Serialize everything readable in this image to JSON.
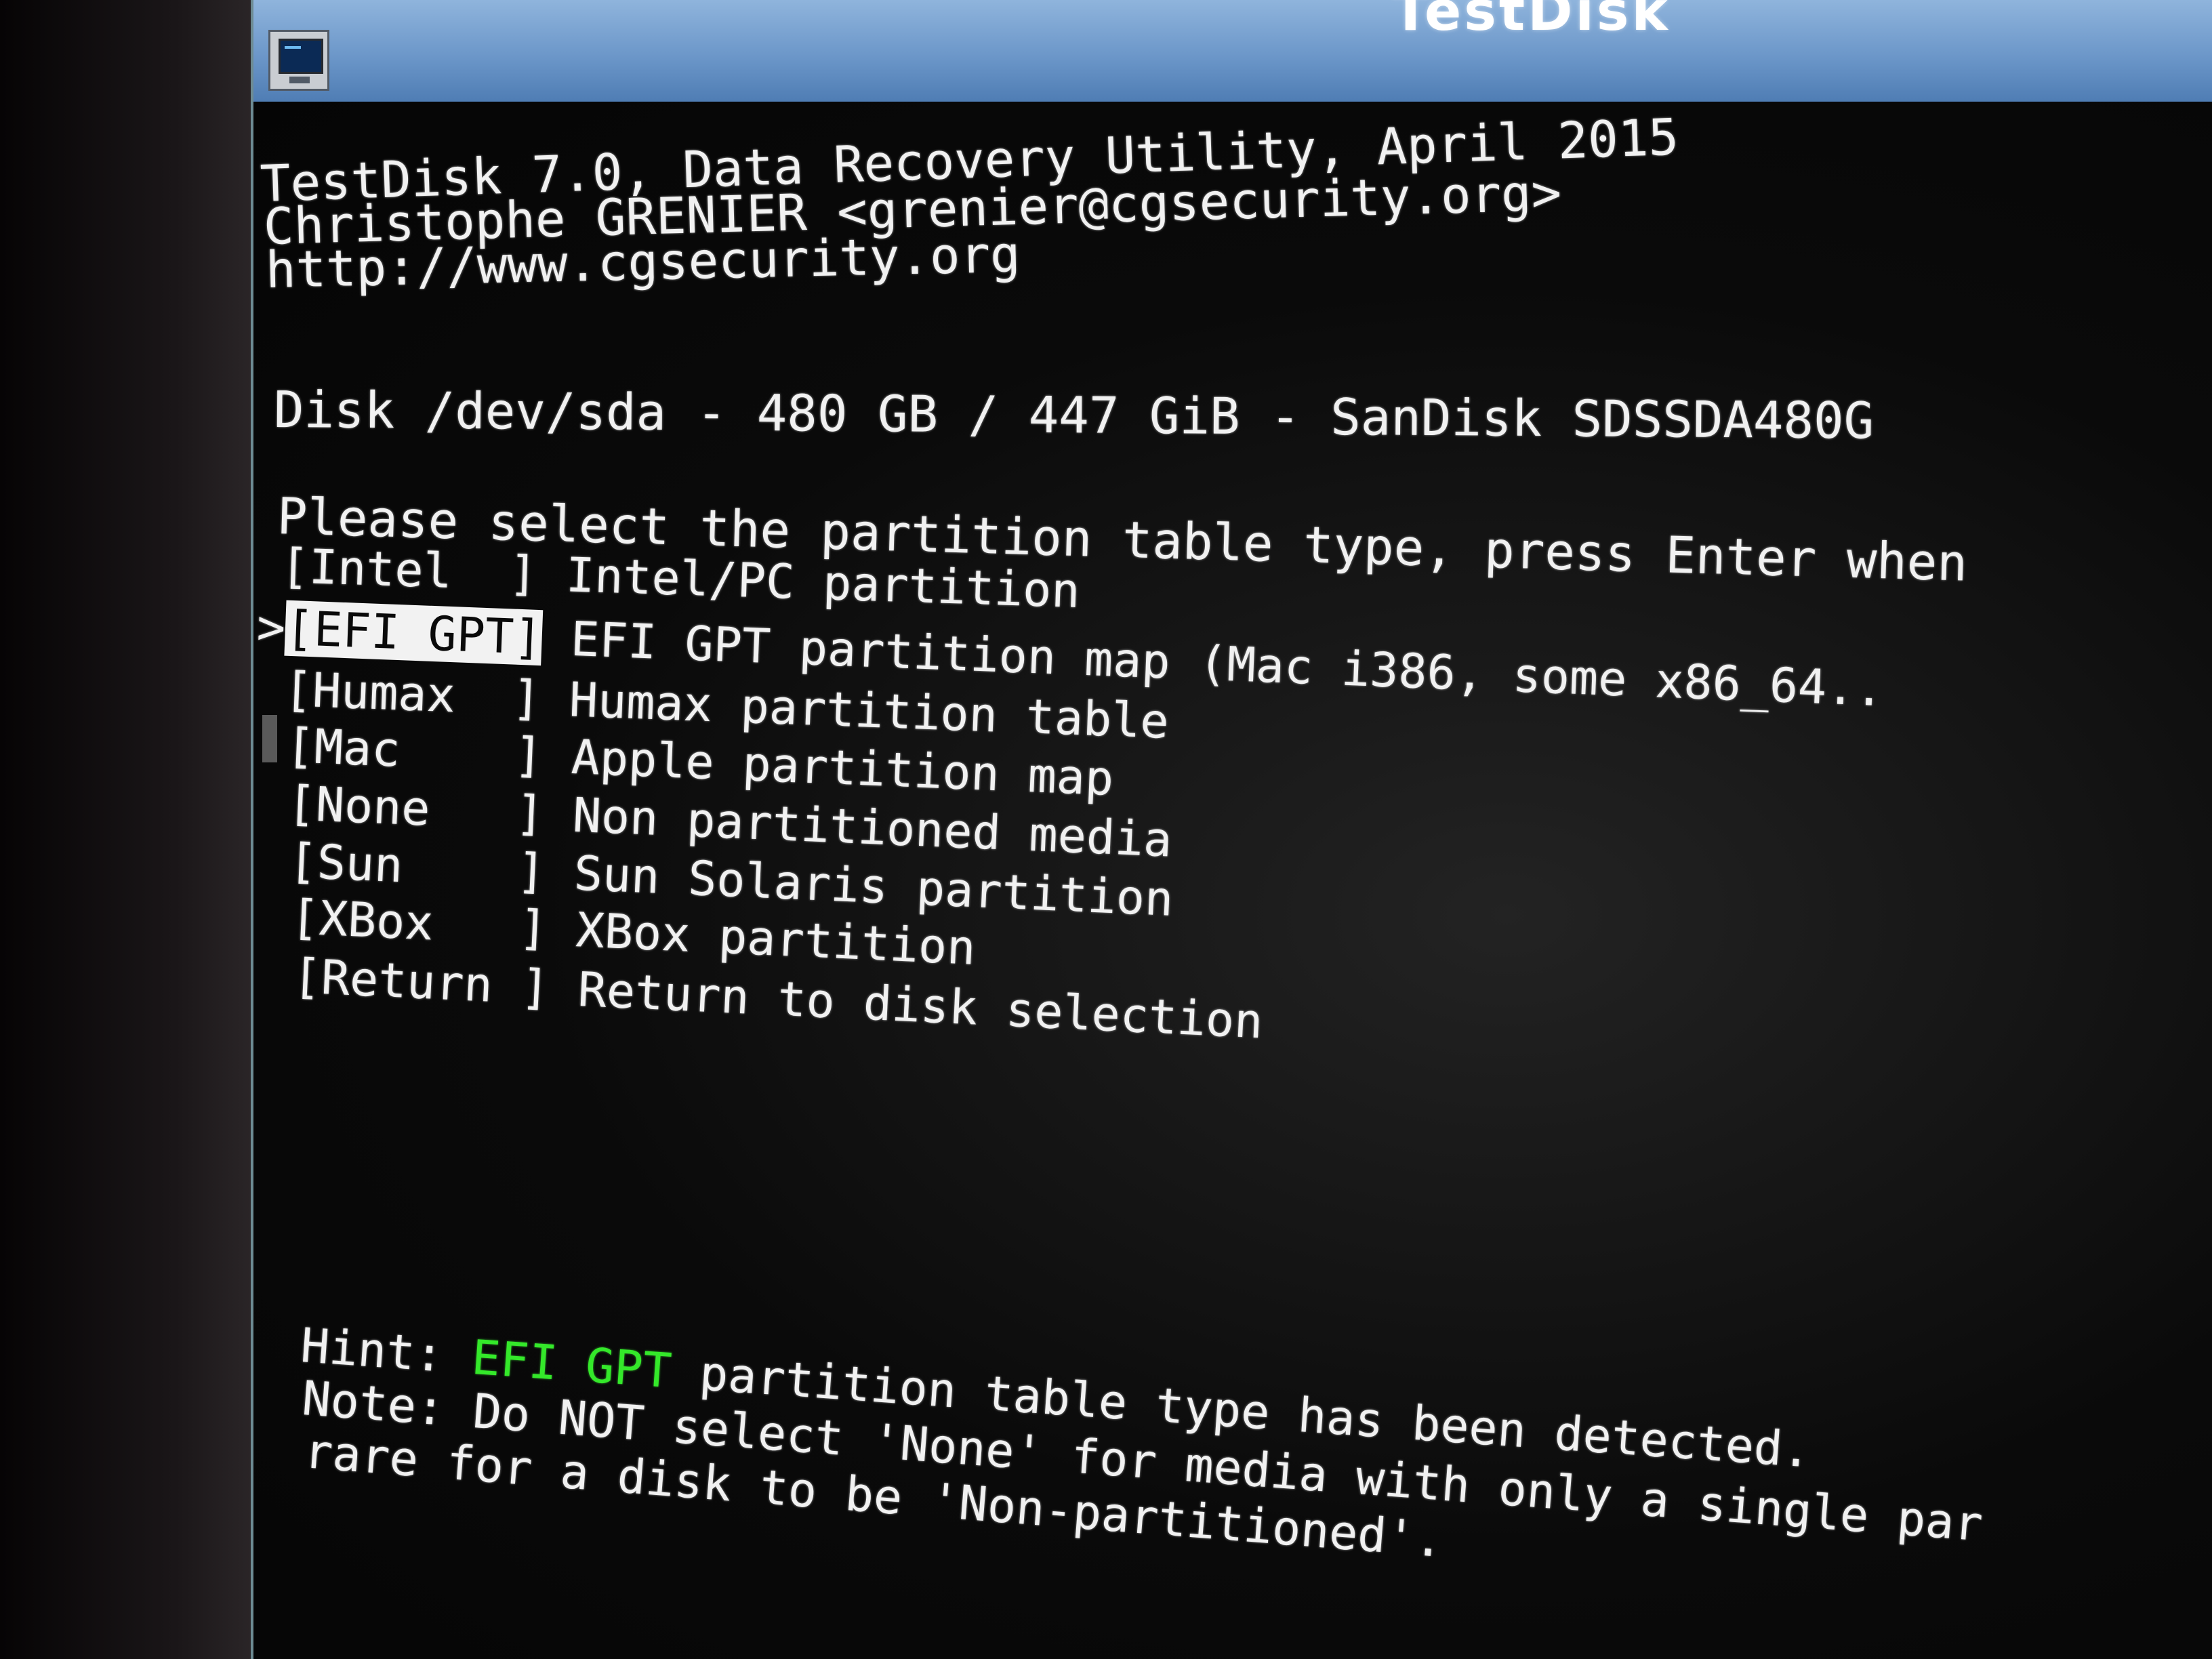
{
  "window": {
    "title": "TestDisk",
    "icon": "terminal-icon"
  },
  "header": {
    "line1": "TestDisk 7.0, Data Recovery Utility, April 2015",
    "line2": "Christophe GRENIER <grenier@cgsecurity.org>",
    "line3": "http://www.cgsecurity.org"
  },
  "disk": {
    "line": "Disk /dev/sda - 480 GB / 447 GiB - SanDisk SDSSDA480G"
  },
  "prompt": "Please select the partition table type, press Enter when",
  "menu": {
    "selected_index": 1,
    "items": [
      {
        "tag": "[Intel  ]",
        "desc": "Intel/PC partition"
      },
      {
        "tag": "[EFI GPT]",
        "desc": "EFI GPT partition map (Mac i386, some x86_64.."
      },
      {
        "tag": "[Humax  ]",
        "desc": "Humax partition table"
      },
      {
        "tag": "[Mac    ]",
        "desc": "Apple partition map"
      },
      {
        "tag": "[None   ]",
        "desc": "Non partitioned media"
      },
      {
        "tag": "[Sun    ]",
        "desc": "Sun Solaris partition"
      },
      {
        "tag": "[XBox   ]",
        "desc": "XBox partition"
      },
      {
        "tag": "[Return ]",
        "desc": "Return to disk selection"
      }
    ],
    "pointer": ">"
  },
  "hint": {
    "label": "Hint: ",
    "detected": "EFI GPT",
    "rest": " partition table type has been detected."
  },
  "note": {
    "line1": "Note: Do NOT select 'None' for media with only a single par",
    "line2": "rare for a disk to be 'Non-partitioned'."
  },
  "colors": {
    "terminal_bg": "#050505",
    "text": "#f1f1f1",
    "highlight": "#34e82a",
    "titlebar": "#6c97c9"
  }
}
